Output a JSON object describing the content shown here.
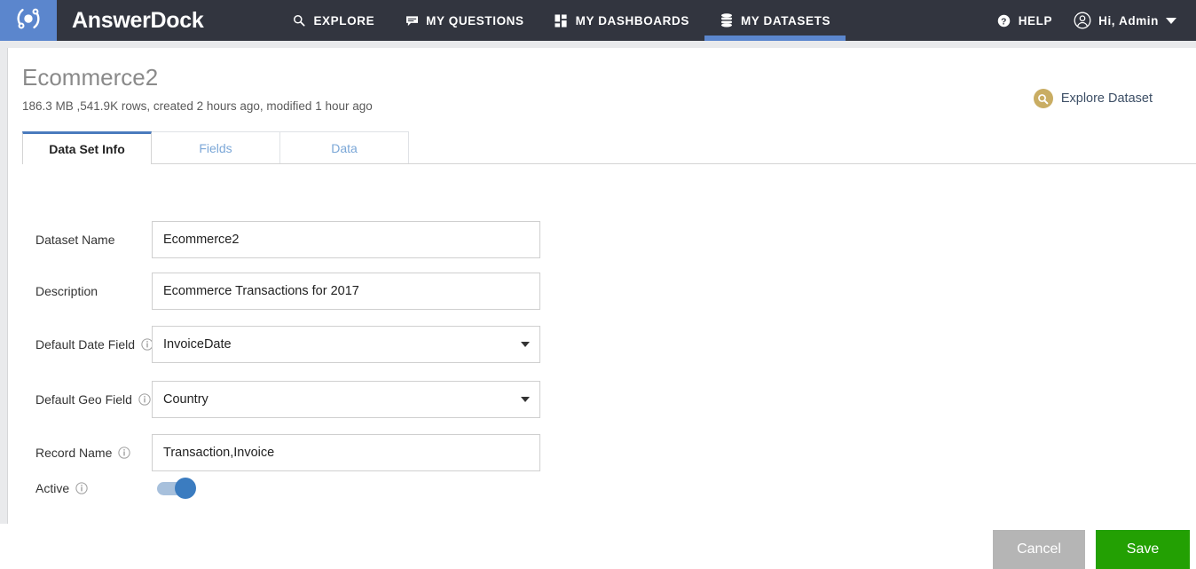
{
  "topnav": {
    "logo_icon": "orbit-logo-icon",
    "brand": "AnswerDock",
    "items": [
      {
        "label": "EXPLORE",
        "icon": "search-icon",
        "active": false
      },
      {
        "label": "MY QUESTIONS",
        "icon": "chat-bubble-icon",
        "active": false
      },
      {
        "label": "MY DASHBOARDS",
        "icon": "grid-tiles-icon",
        "active": false
      },
      {
        "label": "MY DATASETS",
        "icon": "database-icon",
        "active": true
      }
    ],
    "help": {
      "label": "HELP",
      "icon": "question-circle-icon"
    },
    "user": {
      "label": "Hi, Admin",
      "icon": "user-circle-icon",
      "caret": "chevron-down-icon"
    }
  },
  "header": {
    "title": "Ecommerce2",
    "subtitle": "186.3 MB ,541.9K rows, created 2 hours ago, modified 1 hour ago",
    "explore": {
      "label": "Explore Dataset",
      "icon": "search-circle-icon"
    }
  },
  "tabs": [
    {
      "label": "Data Set Info",
      "active": true
    },
    {
      "label": "Fields",
      "active": false
    },
    {
      "label": "Data",
      "active": false
    }
  ],
  "form": {
    "dataset_name": {
      "label": "Dataset Name",
      "value": "Ecommerce2",
      "placeholder": ""
    },
    "description": {
      "label": "Description",
      "value": "Ecommerce Transactions for 2017",
      "placeholder": ""
    },
    "default_date_field": {
      "label": "Default Date Field",
      "value": "InvoiceDate",
      "info": "info-icon"
    },
    "default_geo_field": {
      "label": "Default Geo Field",
      "value": "Country",
      "info": "info-icon"
    },
    "record_name": {
      "label": "Record Name",
      "value": "Transaction,Invoice",
      "placeholder": "",
      "info": "info-icon"
    },
    "active": {
      "label": "Active",
      "state": "on",
      "info": "info-icon"
    }
  },
  "actions": {
    "cancel": "Cancel",
    "save": "Save"
  },
  "colors": {
    "nav_bg": "#32353f",
    "brand_blue": "#5b86cd",
    "accent_blue": "#4a7bbd",
    "save_green": "#23a003",
    "cancel_gray": "#b5b5b5",
    "explore_gold": "#c9ad63",
    "page_bg": "#e9eaec"
  }
}
